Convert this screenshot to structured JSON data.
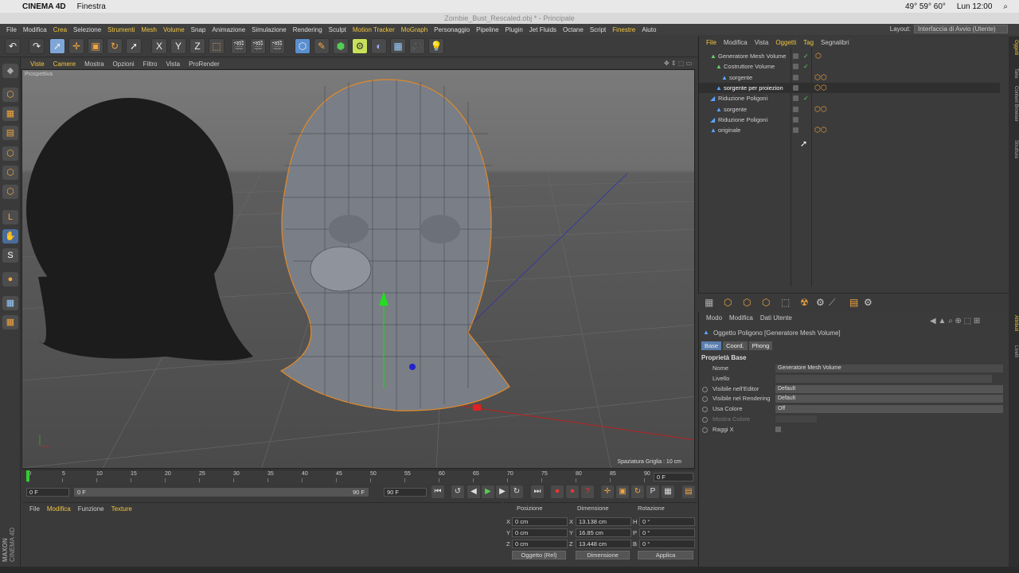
{
  "mac": {
    "apple": "",
    "app": "CINEMA 4D",
    "menu": "Finestra",
    "status": "49° 59° 60°",
    "time": "Lun 12:00"
  },
  "window": {
    "title": "Zombie_Bust_Rescaled.obj * - Principale"
  },
  "menu": [
    "File",
    "Modifica",
    "Crea",
    "Selezione",
    "Strumenti",
    "Mesh",
    "Volume",
    "Snap",
    "Animazione",
    "Simulazione",
    "Rendering",
    "Sculpt",
    "Motion Tracker",
    "MoGraph",
    "Personaggio",
    "Pipeline",
    "Plugin",
    "Jet Fluids",
    "Octane",
    "Script",
    "Finestre",
    "Aiuto"
  ],
  "layout": {
    "label": "Layout:",
    "value": "Interfaccia di Avvio (Utente)"
  },
  "viewport": {
    "menu": [
      "Viste",
      "Camere",
      "Mostra",
      "Opzioni",
      "Filtro",
      "Vista",
      "ProRender"
    ],
    "label": "Prospettiva",
    "grid_spacing": "Spaziatura Griglia : 10 cm"
  },
  "timeline": {
    "ticks": [
      "0",
      "5",
      "10",
      "15",
      "20",
      "25",
      "30",
      "35",
      "40",
      "45",
      "50",
      "55",
      "60",
      "65",
      "70",
      "75",
      "80",
      "85",
      "90"
    ],
    "end_frame": "0 F",
    "current": "0 F",
    "start": "0 F",
    "max": "90 F",
    "min_field": "90 F"
  },
  "materials": {
    "menu": [
      "File",
      "Modifica",
      "Funzione",
      "Texture"
    ]
  },
  "brand": {
    "maxon": "MAXON",
    "product": "CINEMA 4D"
  },
  "coord": {
    "headers": [
      "Posizione",
      "Dimensione",
      "Rotazione"
    ],
    "rows": [
      {
        "a": "X",
        "pos": "0 cm",
        "b": "X",
        "dim": "13.138 cm",
        "c": "H",
        "rot": "0 °"
      },
      {
        "a": "Y",
        "pos": "0 cm",
        "b": "Y",
        "dim": "16.85 cm",
        "c": "P",
        "rot": "0 °"
      },
      {
        "a": "Z",
        "pos": "0 cm",
        "b": "Z",
        "dim": "13.448 cm",
        "c": "B",
        "rot": "0 °"
      }
    ],
    "mode": "Oggetto (Rel)",
    "dim_mode": "Dimensione",
    "apply": "Applica"
  },
  "objects": {
    "menu": [
      "File",
      "Modifica",
      "Vista",
      "Oggetti",
      "Tag",
      "Segnalibri"
    ],
    "rows": [
      {
        "name": "Generatore Mesh Volume",
        "indent": 0
      },
      {
        "name": "Costruttore Volume",
        "indent": 1
      },
      {
        "name": "sorgente",
        "indent": 2
      },
      {
        "name": "sorgente per proiezion",
        "indent": 1
      },
      {
        "name": "Riduzione Poligoni",
        "indent": 0
      },
      {
        "name": "sorgente",
        "indent": 1
      },
      {
        "name": "Riduzione Poligoni",
        "indent": 0
      },
      {
        "name": "originale",
        "indent": 0
      }
    ]
  },
  "attributes": {
    "menu": [
      "Modo",
      "Modifica",
      "Dati Utente"
    ],
    "object_title": "Oggetto Poligono [Generatore Mesh Volume]",
    "tabs": [
      "Base",
      "Coord.",
      "Phong"
    ],
    "section": "Proprietà Base",
    "fields": [
      {
        "label": "Nome",
        "value": "Generatore Mesh Volume"
      },
      {
        "label": "Livello",
        "value": ""
      },
      {
        "label": "Visibile nell'Editor",
        "value": "Default"
      },
      {
        "label": "Visibile nel Rendering",
        "value": "Default"
      },
      {
        "label": "Usa Colore",
        "value": "Off"
      },
      {
        "label": "Mostra Colore",
        "value": ""
      },
      {
        "label": "Raggi X",
        "value": ""
      }
    ]
  },
  "right_tabs": [
    "Oggetti",
    "Take",
    "Content Browser",
    "Struttura",
    "Attributi",
    "Livelli"
  ]
}
